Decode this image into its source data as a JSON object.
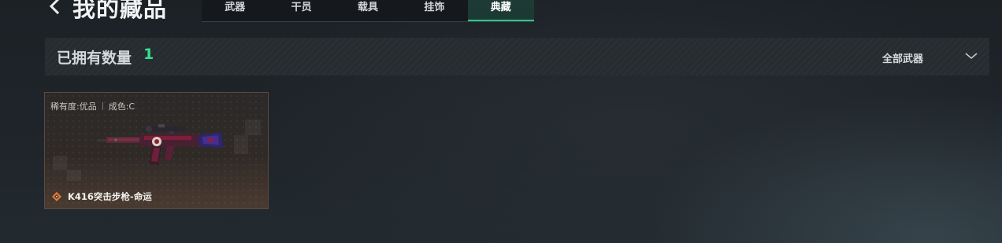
{
  "header": {
    "title": "我的藏品",
    "back_icon": "chevron-left-icon"
  },
  "tabs": [
    {
      "label": "武器",
      "active": false
    },
    {
      "label": "干员",
      "active": false
    },
    {
      "label": "载具",
      "active": false
    },
    {
      "label": "挂饰",
      "active": false
    },
    {
      "label": "典藏",
      "active": true
    }
  ],
  "owned": {
    "label": "已拥有数量",
    "count": "1",
    "filter_label": "全部武器",
    "filter_icon": "chevron-down-icon"
  },
  "items": [
    {
      "rarity": "稀有度:优品",
      "wear": "成色:C",
      "name": "K416突击步枪-命运",
      "rarity_icon": "diamond-icon",
      "rarity_color": "#e07a3c"
    }
  ],
  "colors": {
    "accent_green": "#35e08f",
    "active_tab_underline": "#2fc58a"
  }
}
